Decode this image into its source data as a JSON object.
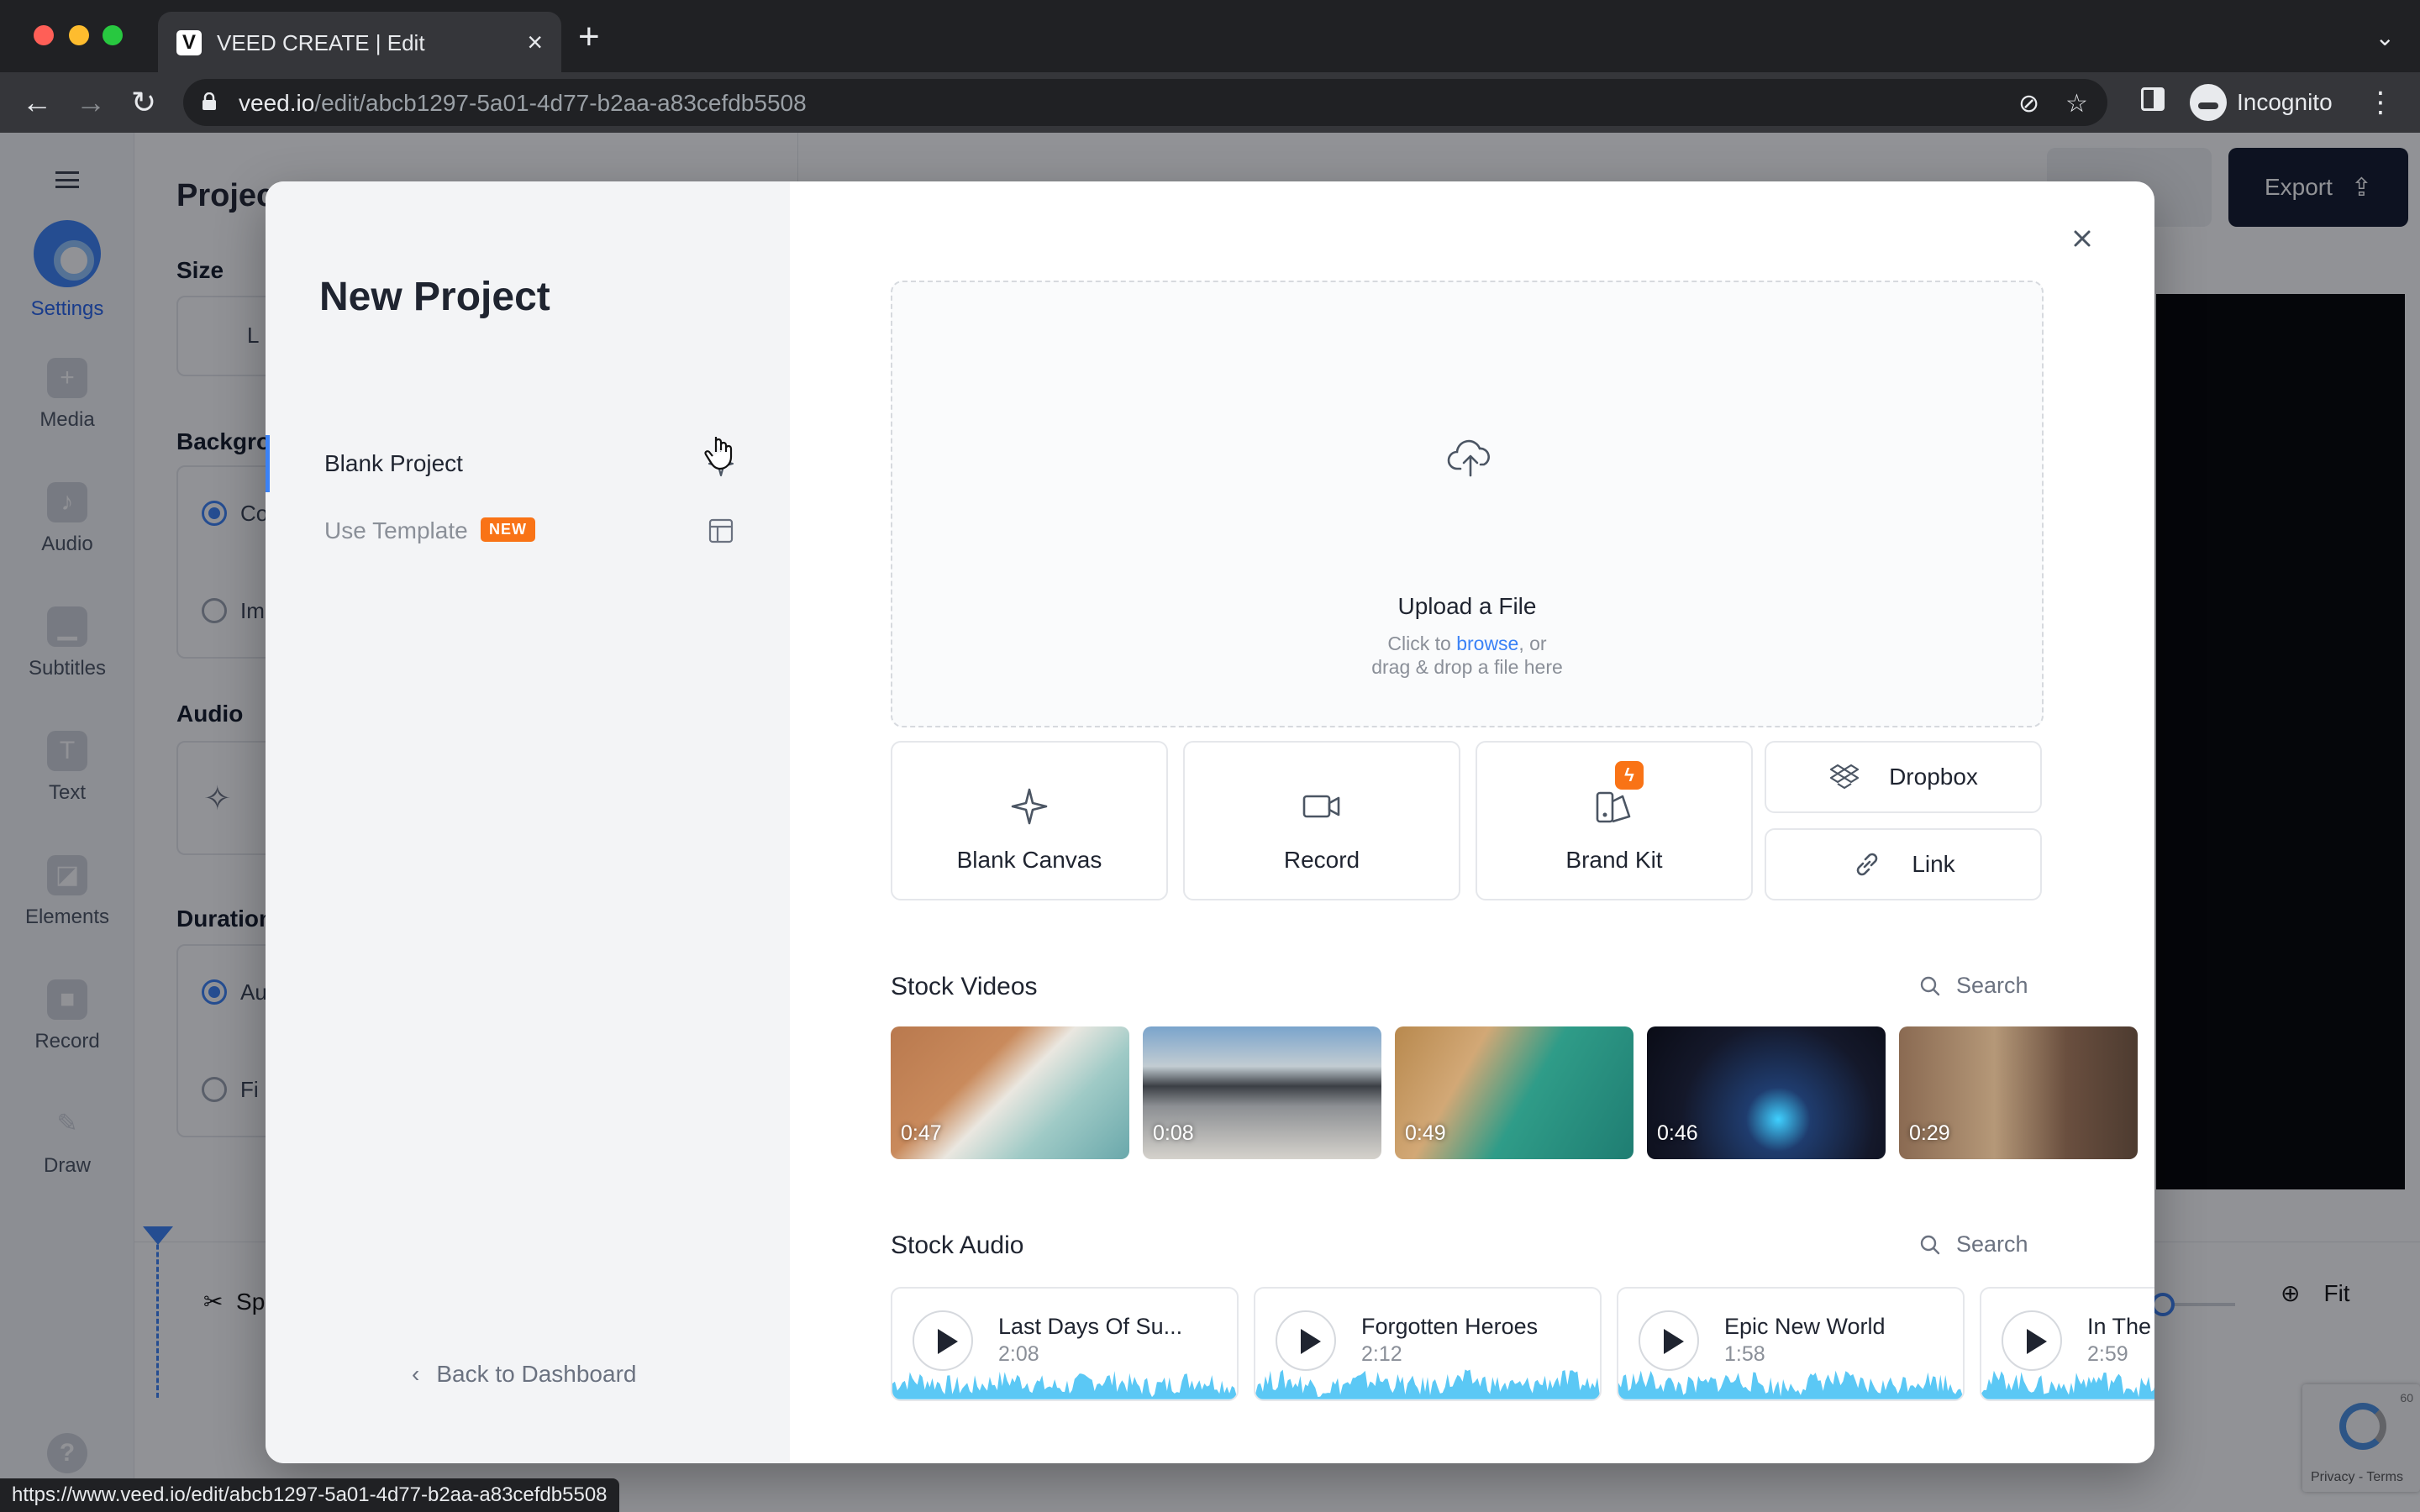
{
  "browser": {
    "tab_title": "VEED CREATE | Edit",
    "favicon_letter": "V",
    "url_host": "veed.io",
    "url_path": "/edit/abcb1297-5a01-4d77-b2aa-a83cefdb5508",
    "profile_label": "Incognito",
    "status_url": "https://www.veed.io/edit/abcb1297-5a01-4d77-b2aa-a83cefdb5508"
  },
  "app": {
    "nav": [
      {
        "label": "Settings",
        "icon": "settings-icon"
      },
      {
        "label": "Media",
        "icon": "plus-icon"
      },
      {
        "label": "Audio",
        "icon": "music-icon"
      },
      {
        "label": "Subtitles",
        "icon": "subtitles-icon"
      },
      {
        "label": "Text",
        "icon": "text-icon"
      },
      {
        "label": "Elements",
        "icon": "elements-icon"
      },
      {
        "label": "Record",
        "icon": "record-icon"
      },
      {
        "label": "Draw",
        "icon": "pen-icon"
      }
    ],
    "panel": {
      "title": "Project",
      "size_label": "Size",
      "size_value": "L",
      "background_label": "Background",
      "bg_opt1": "Co",
      "bg_opt2": "Im",
      "audio_label": "Audio",
      "duration_label": "Duration",
      "dur_opt1": "Au",
      "dur_opt2": "Fi"
    },
    "export_label": "Export",
    "timeline": {
      "split_label": "Sp",
      "fit_label": "Fit",
      "help": "?"
    },
    "recaptcha_text": "Privacy - Terms",
    "recaptcha_badge_number": "60"
  },
  "modal": {
    "title": "New Project",
    "menu": [
      {
        "label": "Blank Project",
        "icon": "sparkle-icon"
      },
      {
        "label": "Use Template",
        "badge": "NEW",
        "icon": "template-icon"
      }
    ],
    "back_label": "Back to Dashboard",
    "upload": {
      "title": "Upload a File",
      "line1_pre": "Click to ",
      "line1_link": "browse",
      "line1_post": ", or",
      "line2": "drag & drop a file here"
    },
    "tiles": [
      {
        "label": "Blank Canvas",
        "icon": "sparkle-icon"
      },
      {
        "label": "Record",
        "icon": "camera-icon"
      },
      {
        "label": "Brand Kit",
        "icon": "brand-kit-icon",
        "badge_icon": "bolt-icon"
      }
    ],
    "small_tiles": [
      {
        "label": "Dropbox",
        "icon": "dropbox-icon"
      },
      {
        "label": "Link",
        "icon": "link-icon"
      }
    ],
    "stock_videos": {
      "title": "Stock Videos",
      "search_label": "Search",
      "items": [
        {
          "duration": "0:47"
        },
        {
          "duration": "0:08"
        },
        {
          "duration": "0:49"
        },
        {
          "duration": "0:46"
        },
        {
          "duration": "0:29"
        }
      ]
    },
    "stock_audio": {
      "title": "Stock Audio",
      "search_label": "Search",
      "items": [
        {
          "title": "Last Days Of Su...",
          "duration": "2:08"
        },
        {
          "title": "Forgotten Heroes",
          "duration": "2:12"
        },
        {
          "title": "Epic New World",
          "duration": "1:58"
        },
        {
          "title": "In The",
          "duration": "2:59"
        }
      ]
    },
    "wave_color": "#5bc8f5"
  }
}
